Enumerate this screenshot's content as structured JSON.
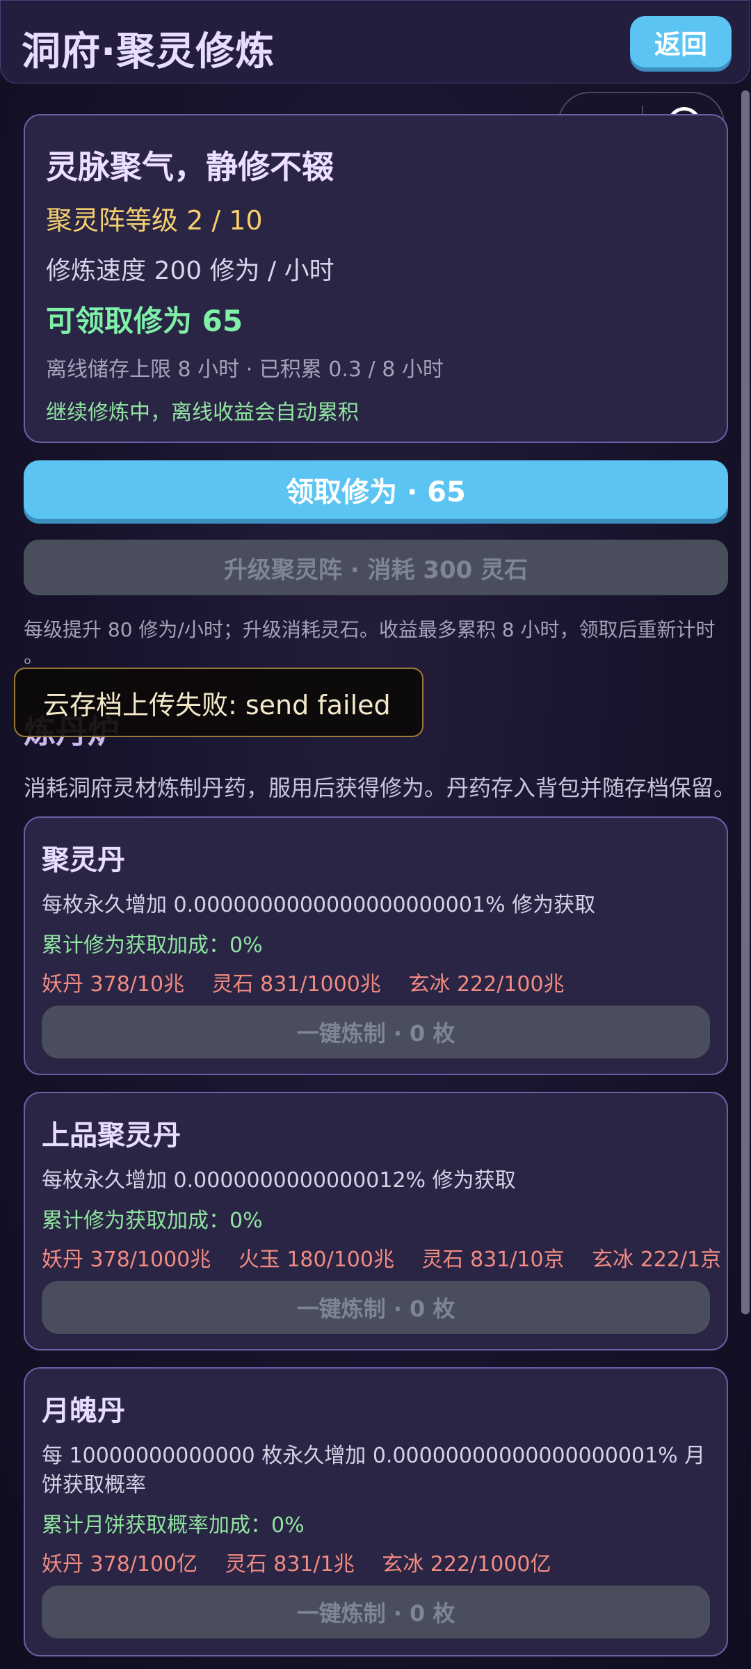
{
  "header": {
    "title": "洞府·聚灵修炼",
    "back_label": "返回"
  },
  "status_card": {
    "title": "灵脉聚气，静修不辍",
    "array_level": "聚灵阵等级  2 / 10",
    "speed": "修炼速度  200 修为 / 小时",
    "claimable": "可领取修为  65",
    "offline_info": "离线储存上限 8 小时 · 已积累 0.3 / 8 小时",
    "hint": "继续修炼中，离线收益会自动累积"
  },
  "actions": {
    "claim_label": "领取修为 · 65",
    "upgrade_label": "升级聚灵阵 · 消耗 300 灵石",
    "upgrade_note_line1": "每级提升 80 修为/小时；升级消耗灵石。收益最多累积 8 小时，领取后重新计时",
    "upgrade_note_line2": "。"
  },
  "toast": {
    "message": "云存档上传失败: send failed"
  },
  "alchemy": {
    "section_title": "炼丹炉",
    "description": "消耗洞府灵材炼制丹药，服用后获得修为。丹药存入背包并随存档保留。",
    "recipes": [
      {
        "name": "聚灵丹",
        "effect_line1": "每枚永久增加 0.0000000000000000000001% 修为获取",
        "effect_line2": "",
        "bonus": "累计修为获取加成：0%",
        "materials": [
          "妖丹 378/10兆",
          "灵石 831/1000兆",
          "玄冰 222/100兆"
        ],
        "button_label": "一键炼制 · 0 枚"
      },
      {
        "name": "上品聚灵丹",
        "effect_line1": "每枚永久增加 0.0000000000000012% 修为获取",
        "effect_line2": "",
        "bonus": "累计修为获取加成：0%",
        "materials": [
          "妖丹 378/1000兆",
          "火玉 180/100兆",
          "灵石 831/10京",
          "玄冰 222/1京"
        ],
        "button_label": "一键炼制 · 0 枚"
      },
      {
        "name": "月魄丹",
        "effect_line1": "每 10000000000000 枚永久增加 0.00000000000000000001% 月",
        "effect_line2": "饼获取概率",
        "bonus": "累计月饼获取概率加成：0%",
        "materials": [
          "妖丹 378/100亿",
          "灵石 831/1兆",
          "玄冰 222/1000亿"
        ],
        "button_label": "一键炼制 · 0 枚"
      }
    ]
  }
}
